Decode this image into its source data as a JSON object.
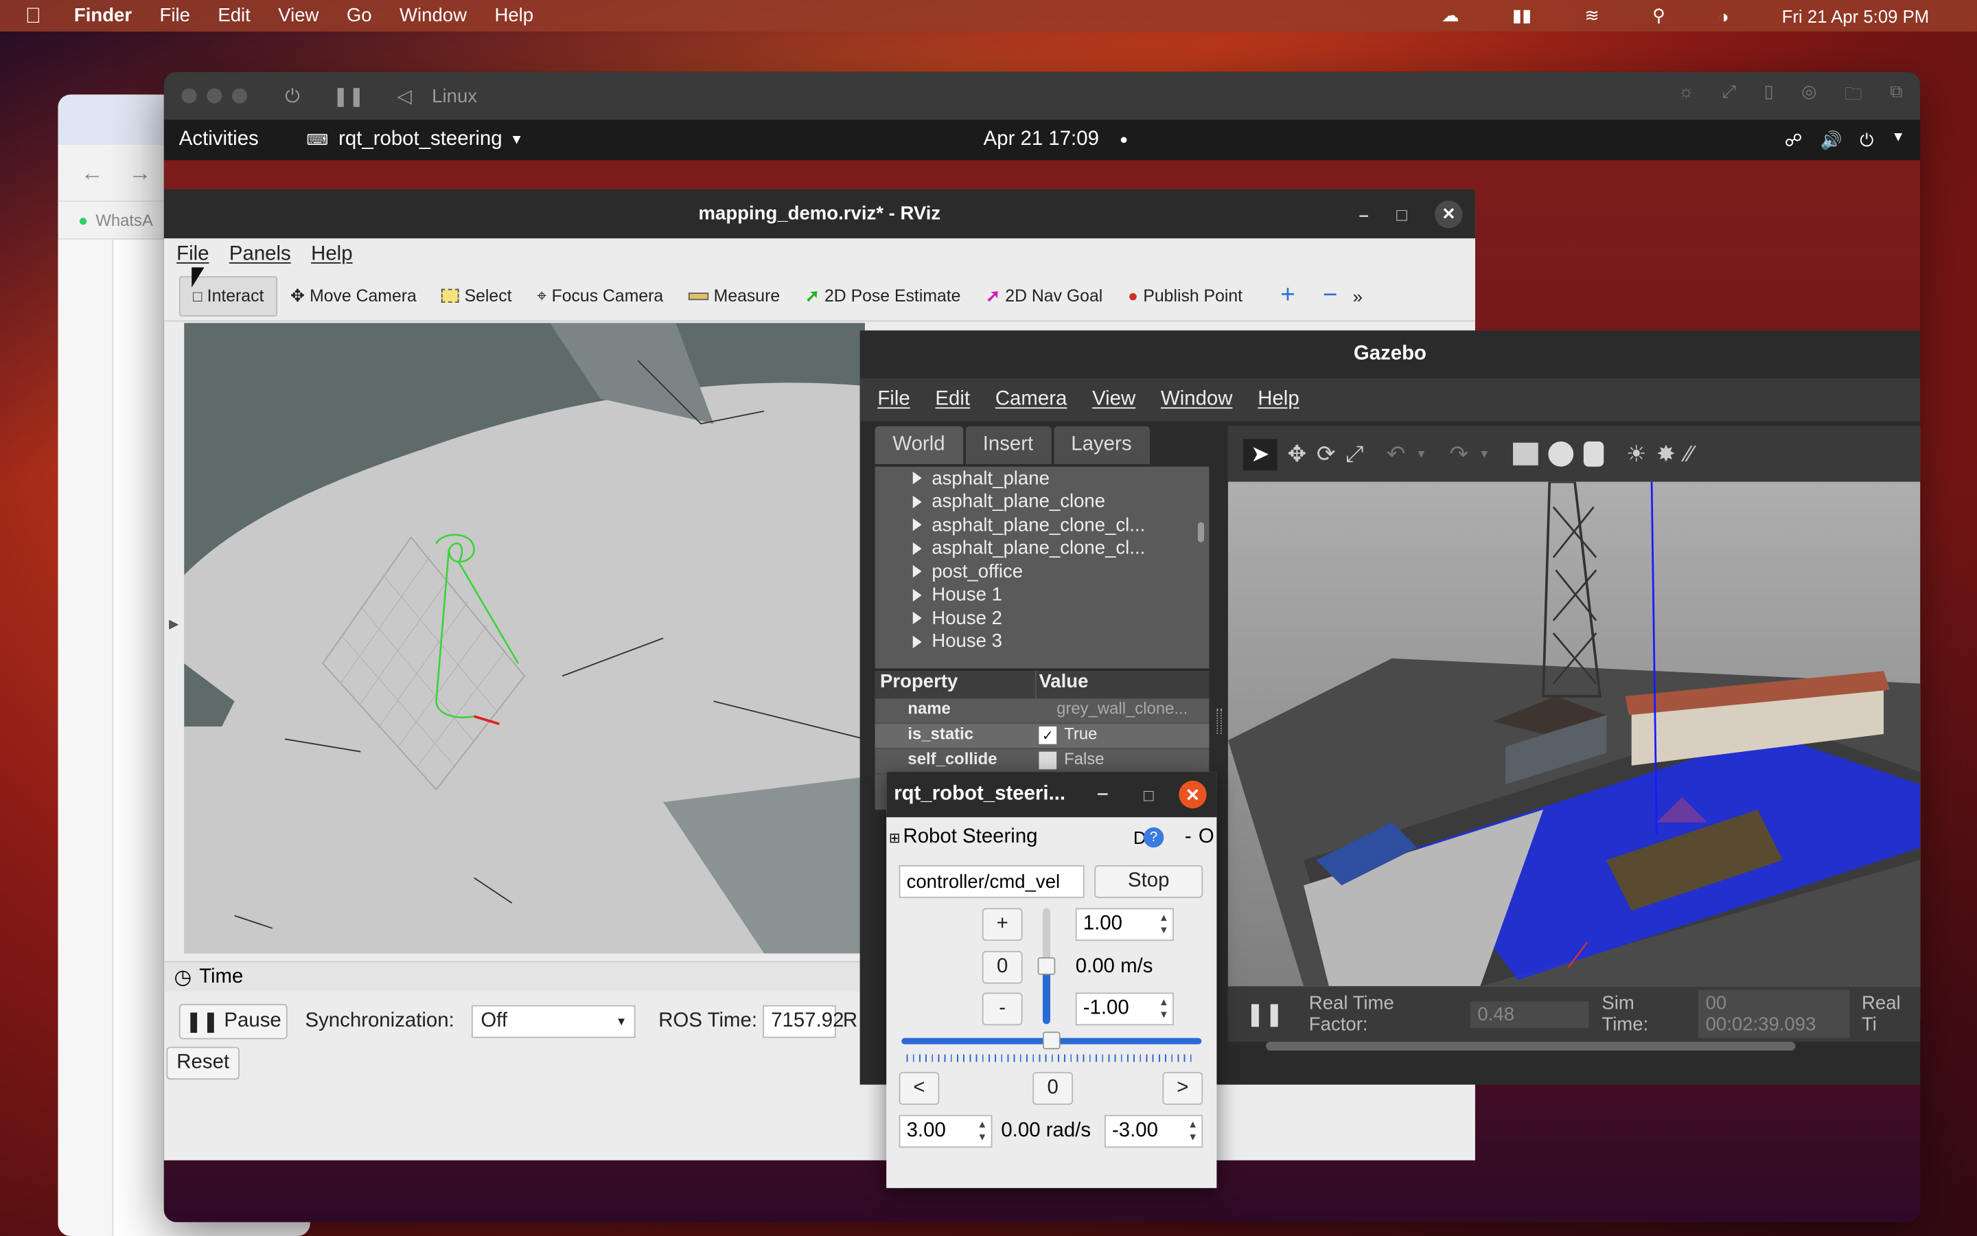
{
  "macos": {
    "app_name": "Finder",
    "menu": [
      "File",
      "Edit",
      "View",
      "Go",
      "Window",
      "Help"
    ],
    "datetime": "Fri 21 Apr  5:09 PM"
  },
  "browser": {
    "whatsapp_label": "WhatsA"
  },
  "vm": {
    "title": "Linux"
  },
  "gnome": {
    "activities": "Activities",
    "app_menu": "rqt_robot_steering",
    "clock": "Apr 21  17:09"
  },
  "rviz": {
    "title": "mapping_demo.rviz* - RViz",
    "menu": [
      "File",
      "Panels",
      "Help"
    ],
    "tools": [
      "Interact",
      "Move Camera",
      "Select",
      "Focus Camera",
      "Measure",
      "2D Pose Estimate",
      "2D Nav Goal",
      "Publish Point"
    ],
    "time_panel_label": "Time",
    "pause_label": "Pause",
    "sync_label": "Synchronization:",
    "sync_value": "Off",
    "ros_time_label": "ROS Time:",
    "ros_time_value": "7157.92",
    "ros_time_suffix": "R",
    "reset_label": "Reset"
  },
  "gazebo": {
    "title": "Gazebo",
    "menu": [
      "File",
      "Edit",
      "Camera",
      "View",
      "Window",
      "Help"
    ],
    "tabs": [
      "World",
      "Insert",
      "Layers"
    ],
    "models": [
      "asphalt_plane",
      "asphalt_plane_clone",
      "asphalt_plane_clone_cl...",
      "asphalt_plane_clone_cl...",
      "post_office",
      "House 1",
      "House 2",
      "House 3"
    ],
    "prop_header": [
      "Property",
      "Value"
    ],
    "props": [
      {
        "name": "name",
        "value": "grey_wall_clone..."
      },
      {
        "name": "is_static",
        "value": "True",
        "checked": true
      },
      {
        "name": "self_collide",
        "value": "False",
        "checked": false
      }
    ],
    "rtf_label": "Real Time Factor:",
    "rtf_value": "0.48",
    "sim_time_label": "Sim Time:",
    "sim_time_value": "00 00:02:39.093",
    "real_time_label": "Real Ti"
  },
  "rqt": {
    "title": "rqt_robot_steeri...",
    "plugin_label": "Robot Steering",
    "plugin_controls": "D",
    "plugin_dash": "-",
    "plugin_o": "O",
    "topic": "controller/cmd_vel",
    "stop_label": "Stop",
    "plus_label": "+",
    "zero_label": "0",
    "minus_label": "-",
    "max_linear": "1.00",
    "linear_speed": "0.00 m/s",
    "min_linear": "-1.00",
    "left_label": "<",
    "zero_angular": "0",
    "right_label": ">",
    "max_angular": "3.00",
    "angular_speed": "0.00 rad/s",
    "min_angular": "-3.00"
  }
}
